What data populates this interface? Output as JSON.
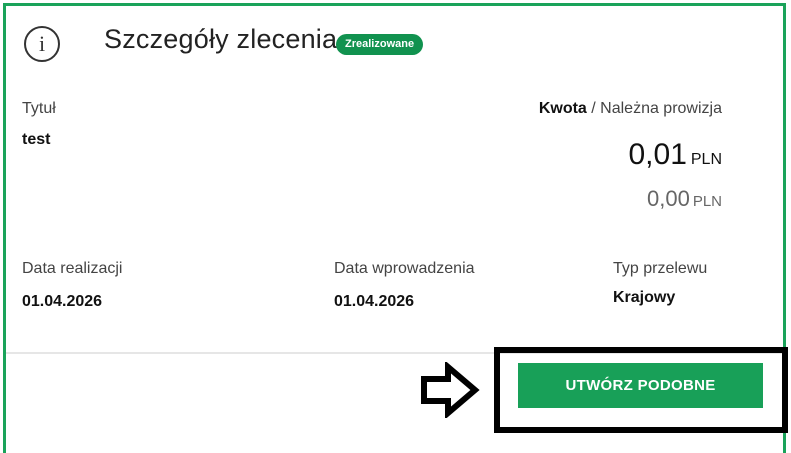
{
  "header": {
    "title": "Szczegóły zlecenia",
    "status_badge": "Zrealizowane",
    "info_icon": "info-circle-icon"
  },
  "details": {
    "title_label": "Tytuł",
    "title_value": "test",
    "amount_label": "Kwota",
    "amount_separator": " / ",
    "commission_label": "Należna prowizja",
    "amount_value": "0,01",
    "amount_currency": "PLN",
    "commission_value": "0,00",
    "commission_currency": "PLN",
    "execution_date_label": "Data realizacji",
    "execution_date_value": "01.04.2026",
    "entry_date_label": "Data wprowadzenia",
    "entry_date_value": "01.04.2026",
    "transfer_type_label": "Typ przelewu",
    "transfer_type_value": "Krajowy"
  },
  "actions": {
    "create_similar_label": "UTWÓRZ PODOBNE",
    "pointer_icon": "arrow-right-icon"
  },
  "colors": {
    "accent_green": "#18a058",
    "frame_green": "#1aa35a",
    "badge_green": "#11924f"
  }
}
